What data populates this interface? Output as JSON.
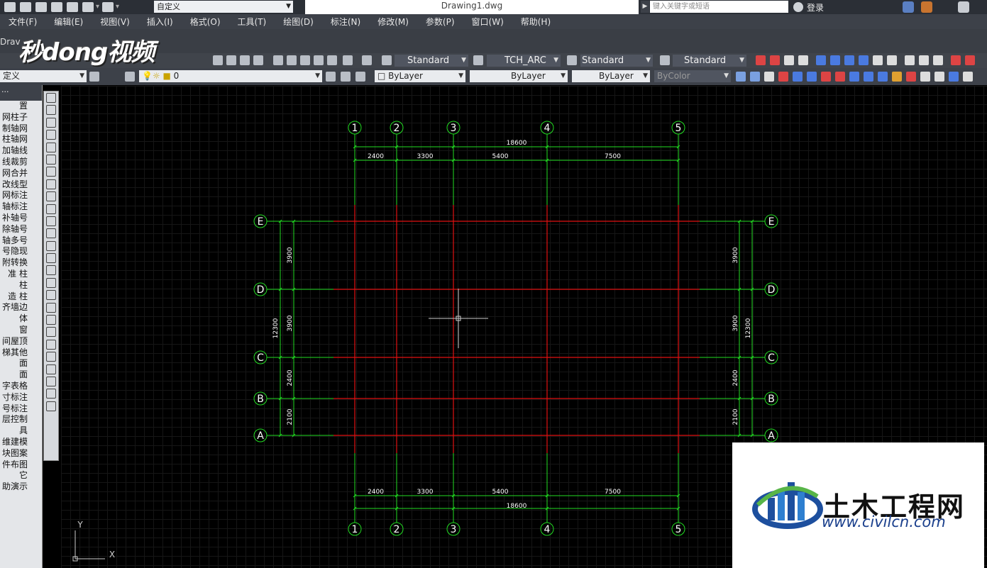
{
  "titlebar": {
    "workspace": "自定义",
    "document_title": "Drawing1.dwg",
    "search_placeholder": "键入关键字或短语",
    "login": "登录"
  },
  "menu": [
    "文件(F)",
    "编辑(E)",
    "视图(V)",
    "插入(I)",
    "格式(O)",
    "工具(T)",
    "绘图(D)",
    "标注(N)",
    "修改(M)",
    "参数(P)",
    "窗口(W)",
    "帮助(H)"
  ],
  "watermark_top": {
    "logo": "秒dong视频",
    "tab_text": "Drav"
  },
  "toolbar_styles": {
    "text_style": "Standard",
    "dim_style": "TCH_ARC",
    "table_style": "Standard",
    "multileader_style": "Standard"
  },
  "layers": {
    "workspace_partial": "定义",
    "layer_name": "0",
    "color": "ByLayer",
    "linetype": "ByLayer",
    "lineweight": "ByLayer",
    "plotstyle": "ByColor"
  },
  "palette": {
    "header": "...",
    "items": [
      "置",
      "网柱子",
      "制轴网",
      "柱轴网",
      "加轴线",
      "线裁剪",
      "网合并",
      "改线型",
      "网标注",
      "轴标注",
      "补轴号",
      "除轴号",
      "轴多号",
      "号隐现",
      "附转换",
      "准 柱",
      "柱",
      "造 柱",
      "齐墙边",
      "体",
      "窗",
      "间屋顶",
      "梯其他",
      "面",
      "面",
      "字表格",
      "寸标注",
      "号标注",
      "层控制",
      "具",
      "维建模",
      "块图案",
      "件布图",
      "它",
      "助演示"
    ]
  },
  "drawing": {
    "column_axes": [
      "1",
      "2",
      "3",
      "4",
      "5"
    ],
    "row_axes": [
      "E",
      "D",
      "C",
      "B",
      "A"
    ],
    "bay_widths": [
      "2400",
      "3300",
      "5400",
      "7500"
    ],
    "total_width": "18600",
    "bay_depths": [
      "3900",
      "3900",
      "2400",
      "2100"
    ],
    "total_depth": "12300",
    "ucs_x": "X",
    "ucs_y": "Y",
    "colors": {
      "axis": "#e01010",
      "dimension": "#22dd22",
      "bubble": "#22dd22",
      "text": "#ffffff",
      "cursor": "#cccccc"
    }
  },
  "watermark_bottom": {
    "title": "土木工程网",
    "url": "www.civilcn.com"
  }
}
